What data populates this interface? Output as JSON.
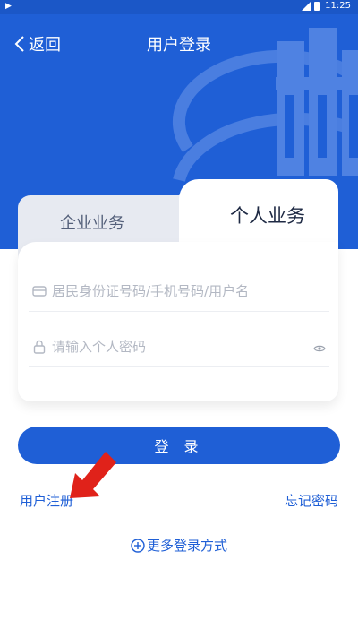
{
  "status_bar": {
    "time": "11:25"
  },
  "nav": {
    "back_label": "返回",
    "title": "用户登录"
  },
  "tabs": {
    "enterprise": "企业业务",
    "personal": "个人业务"
  },
  "form": {
    "id_placeholder": "居民身份证号码/手机号码/用户名",
    "password_placeholder": "请输入个人密码"
  },
  "actions": {
    "login": "登 录",
    "register": "用户注册",
    "forgot": "忘记密码",
    "more": "更多登录方式"
  },
  "colors": {
    "primary": "#1f5fd6",
    "annotation_arrow": "#e0221a"
  }
}
